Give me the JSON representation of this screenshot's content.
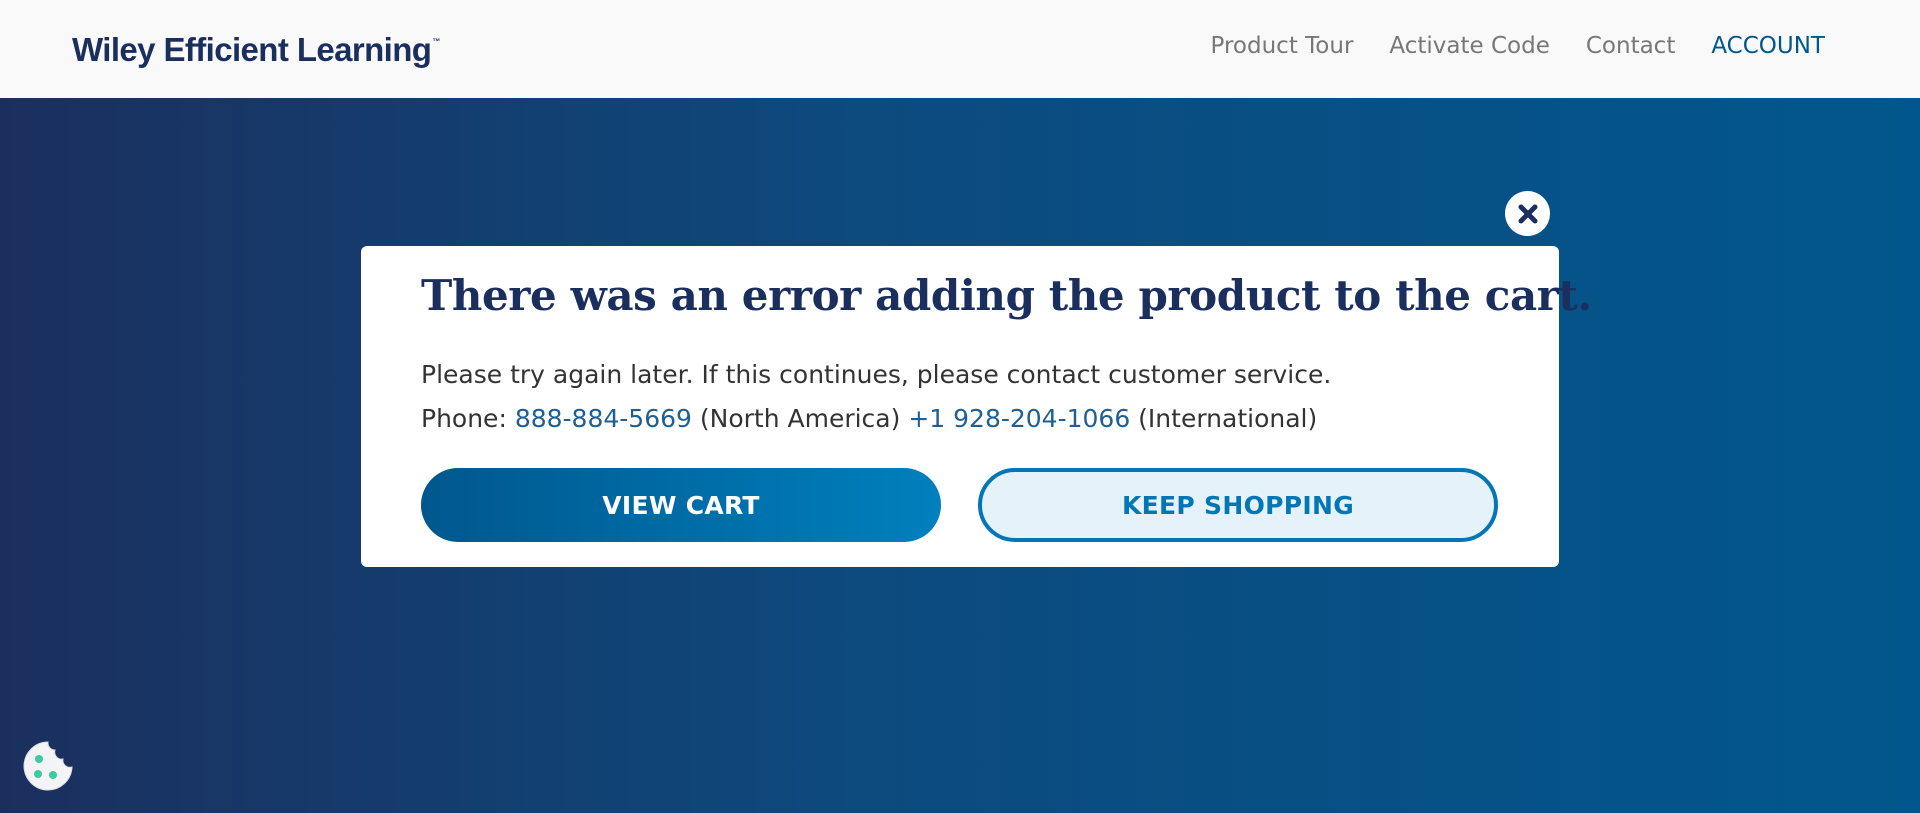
{
  "header": {
    "logo_text": "Wiley Efficient Learning",
    "logo_tm": "™",
    "nav": [
      {
        "label": "Product Tour"
      },
      {
        "label": "Activate Code"
      },
      {
        "label": "Contact"
      },
      {
        "label": "ACCOUNT"
      }
    ]
  },
  "modal": {
    "close_icon": "close-icon",
    "title": "There was an error adding the product to the cart.",
    "message": "Please try again later. If this continues, please contact customer service.",
    "phone_prefix": "Phone: ",
    "phone_na": "888-884-5669",
    "phone_na_suffix": " (North America) ",
    "phone_intl": "+1 928-204-1066",
    "phone_intl_suffix": " (International)",
    "view_cart_label": "VIEW CART",
    "keep_shopping_label": "KEEP SHOPPING"
  },
  "cookie_badge": {
    "icon": "cookie-icon"
  },
  "colors": {
    "navy": "#1b2f5e",
    "accent_blue": "#00578e",
    "link_blue": "#1e5f96",
    "button_outline": "#0377b6",
    "cookie_dots": "#3dc9a1"
  }
}
